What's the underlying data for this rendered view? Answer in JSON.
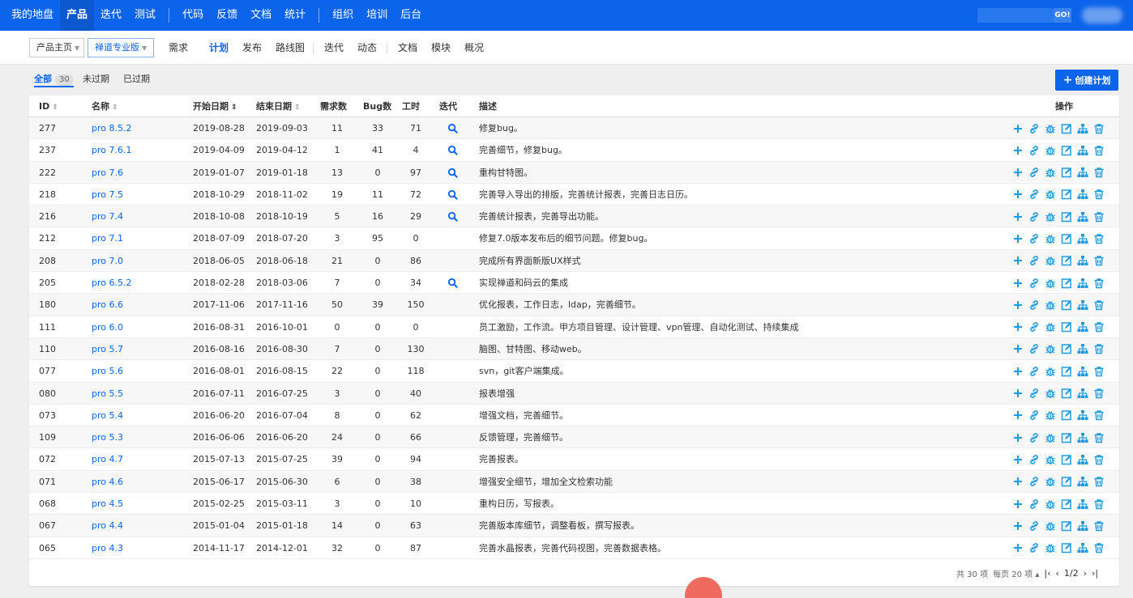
{
  "topnav": {
    "items": [
      "我的地盘",
      "产品",
      "迭代",
      "测试",
      "代码",
      "反馈",
      "文档",
      "统计",
      "组织",
      "培训",
      "后台"
    ],
    "active": "产品",
    "search_go": "GO!"
  },
  "subnav": {
    "crumb_home": "产品主页",
    "crumb_product": "禅道专业版",
    "items": [
      "需求",
      "计划",
      "发布",
      "路线图",
      "迭代",
      "动态",
      "文档",
      "模块",
      "概况"
    ],
    "active": "计划"
  },
  "filters": {
    "all": "全部",
    "all_count": "30",
    "unexpired": "未过期",
    "expired": "已过期"
  },
  "create_button": "创建计划",
  "table": {
    "headers": {
      "id": "ID",
      "name": "名称",
      "start": "开始日期",
      "end": "结束日期",
      "stories": "需求数",
      "bugs": "Bug数",
      "hours": "工时",
      "iteration": "迭代",
      "desc": "描述",
      "ops": "操作"
    },
    "rows": [
      {
        "id": "277",
        "name": "pro 8.5.2",
        "start": "2019-08-28",
        "end": "2019-09-03",
        "stories": "11",
        "bugs": "33",
        "hours": "71",
        "iter": true,
        "desc": "修复bug。"
      },
      {
        "id": "237",
        "name": "pro 7.6.1",
        "start": "2019-04-09",
        "end": "2019-04-12",
        "stories": "1",
        "bugs": "41",
        "hours": "4",
        "iter": true,
        "desc": "完善细节，修复bug。"
      },
      {
        "id": "222",
        "name": "pro 7.6",
        "start": "2019-01-07",
        "end": "2019-01-18",
        "stories": "13",
        "bugs": "0",
        "hours": "97",
        "iter": true,
        "desc": "重构甘特图。"
      },
      {
        "id": "218",
        "name": "pro 7.5",
        "start": "2018-10-29",
        "end": "2018-11-02",
        "stories": "19",
        "bugs": "11",
        "hours": "72",
        "iter": true,
        "desc": "完善导入导出的排版，完善统计报表，完善日志日历。"
      },
      {
        "id": "216",
        "name": "pro 7.4",
        "start": "2018-10-08",
        "end": "2018-10-19",
        "stories": "5",
        "bugs": "16",
        "hours": "29",
        "iter": true,
        "desc": "完善统计报表，完善导出功能。"
      },
      {
        "id": "212",
        "name": "pro 7.1",
        "start": "2018-07-09",
        "end": "2018-07-20",
        "stories": "3",
        "bugs": "95",
        "hours": "0",
        "iter": false,
        "desc": "修复7.0版本发布后的细节问题。修复bug。"
      },
      {
        "id": "208",
        "name": "pro 7.0",
        "start": "2018-06-05",
        "end": "2018-06-18",
        "stories": "21",
        "bugs": "0",
        "hours": "86",
        "iter": false,
        "desc": "完成所有界面新版UX样式"
      },
      {
        "id": "205",
        "name": "pro 6.5.2",
        "start": "2018-02-28",
        "end": "2018-03-06",
        "stories": "7",
        "bugs": "0",
        "hours": "34",
        "iter": true,
        "desc": "实现禅道和码云的集成"
      },
      {
        "id": "180",
        "name": "pro 6.6",
        "start": "2017-11-06",
        "end": "2017-11-16",
        "stories": "50",
        "bugs": "39",
        "hours": "150",
        "iter": false,
        "desc": "优化报表，工作日志，ldap，完善细节。"
      },
      {
        "id": "111",
        "name": "pro 6.0",
        "start": "2016-08-31",
        "end": "2016-10-01",
        "stories": "0",
        "bugs": "0",
        "hours": "0",
        "iter": false,
        "desc": "员工激励，工作流。甲方项目管理、设计管理、vpn管理、自动化测试、持续集成"
      },
      {
        "id": "110",
        "name": "pro 5.7",
        "start": "2016-08-16",
        "end": "2016-08-30",
        "stories": "7",
        "bugs": "0",
        "hours": "130",
        "iter": false,
        "desc": "脑图、甘特图、移动web。"
      },
      {
        "id": "077",
        "name": "pro 5.6",
        "start": "2016-08-01",
        "end": "2016-08-15",
        "stories": "22",
        "bugs": "0",
        "hours": "118",
        "iter": false,
        "desc": "svn，git客户端集成。"
      },
      {
        "id": "080",
        "name": "pro 5.5",
        "start": "2016-07-11",
        "end": "2016-07-25",
        "stories": "3",
        "bugs": "0",
        "hours": "40",
        "iter": false,
        "desc": "报表增强"
      },
      {
        "id": "073",
        "name": "pro 5.4",
        "start": "2016-06-20",
        "end": "2016-07-04",
        "stories": "8",
        "bugs": "0",
        "hours": "62",
        "iter": false,
        "desc": "增强文档，完善细节。"
      },
      {
        "id": "109",
        "name": "pro 5.3",
        "start": "2016-06-06",
        "end": "2016-06-20",
        "stories": "24",
        "bugs": "0",
        "hours": "66",
        "iter": false,
        "desc": "反馈管理，完善细节。"
      },
      {
        "id": "072",
        "name": "pro 4.7",
        "start": "2015-07-13",
        "end": "2015-07-25",
        "stories": "39",
        "bugs": "0",
        "hours": "94",
        "iter": false,
        "desc": "完善报表。"
      },
      {
        "id": "071",
        "name": "pro 4.6",
        "start": "2015-06-17",
        "end": "2015-06-30",
        "stories": "6",
        "bugs": "0",
        "hours": "38",
        "iter": false,
        "desc": "增强安全细节，增加全文检索功能"
      },
      {
        "id": "068",
        "name": "pro 4.5",
        "start": "2015-02-25",
        "end": "2015-03-11",
        "stories": "3",
        "bugs": "0",
        "hours": "10",
        "iter": false,
        "desc": "重构日历，写报表。"
      },
      {
        "id": "067",
        "name": "pro 4.4",
        "start": "2015-01-04",
        "end": "2015-01-18",
        "stories": "14",
        "bugs": "0",
        "hours": "63",
        "iter": false,
        "desc": "完善版本库细节，调整看板，撰写报表。"
      },
      {
        "id": "065",
        "name": "pro 4.3",
        "start": "2014-11-17",
        "end": "2014-12-01",
        "stories": "32",
        "bugs": "0",
        "hours": "87",
        "iter": false,
        "desc": "完善水晶报表，完善代码视图，完善数据表格。"
      }
    ]
  },
  "pager": {
    "total": "共 30 项",
    "per_page": "每页 20 项",
    "page": "1/2"
  },
  "colors": {
    "brand": "#0c64eb",
    "icon": "#1f9ce0"
  }
}
